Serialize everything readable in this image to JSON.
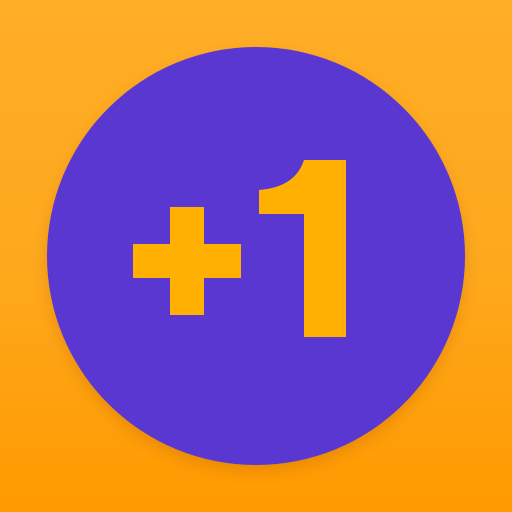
{
  "icon": {
    "plus_glyph": "+",
    "number_text": "1",
    "label": "+1"
  },
  "colors": {
    "background_top": "#FFAE27",
    "background_bottom": "#FF9A00",
    "circle": "#5B37D2",
    "glyph": "#FFB000"
  }
}
